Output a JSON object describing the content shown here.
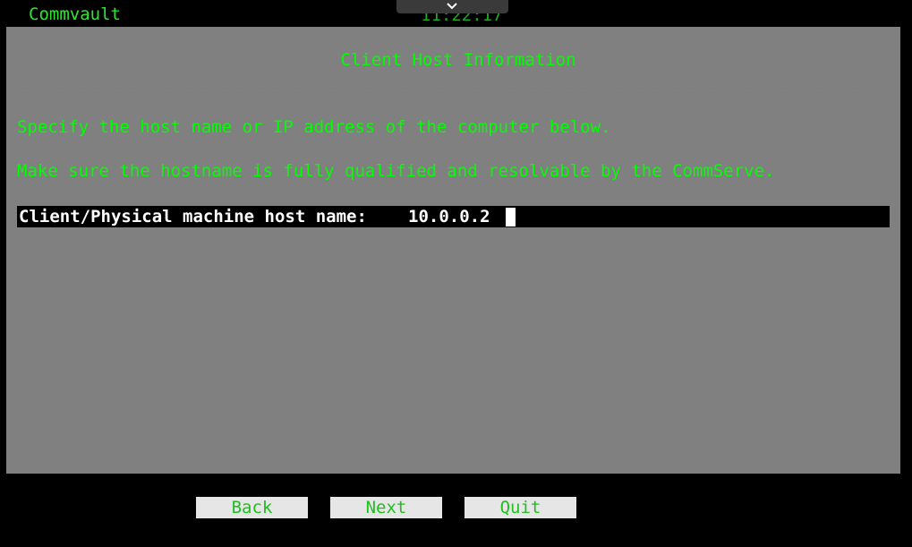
{
  "header": {
    "app_name": "Commvault",
    "clock": "11:22:17",
    "pull_tab_icon": "chevron-down-icon"
  },
  "dialog": {
    "title": "Client Host Information",
    "separator": "________________________________________________________________________________________________",
    "instructions": [
      "Specify the host name or IP address of the computer below.",
      "Make sure the hostname is fully qualified and resolvable by the CommServe."
    ],
    "field": {
      "label": "Client/Physical machine host name:",
      "value": "10.0.0.2"
    }
  },
  "buttons": {
    "back": "Back",
    "next": "Next",
    "quit": "Quit"
  },
  "colors": {
    "background": "#000000",
    "panel": "#808080",
    "text_green": "#00ff00",
    "field_bg": "#000000",
    "button_bg": "#e6e6e6"
  }
}
